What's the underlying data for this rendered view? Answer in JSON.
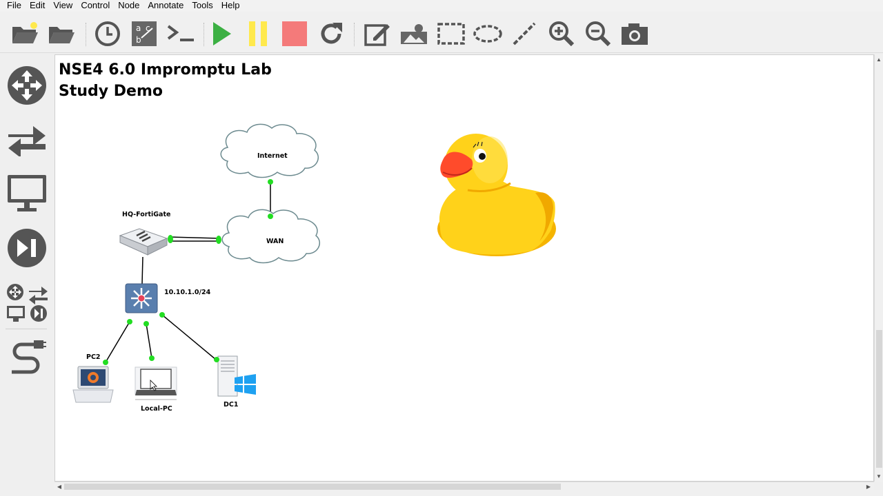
{
  "menu": [
    "File",
    "Edit",
    "View",
    "Control",
    "Node",
    "Annotate",
    "Tools",
    "Help"
  ],
  "toolbar": {
    "buttons": [
      "open-project",
      "open-folder",
      "snapshot-clock",
      "show-hide-interface-labels",
      "console-all",
      "start-all",
      "suspend-all",
      "stop-all",
      "reload-all",
      "add-note",
      "insert-picture",
      "draw-rectangle",
      "draw-ellipse",
      "draw-line",
      "zoom-in",
      "zoom-out",
      "screenshot"
    ],
    "colors": {
      "start": "#3cb043",
      "suspend": "#ffe94d",
      "stop": "#f47a7a",
      "icon": "#555555"
    }
  },
  "dock": [
    "routers",
    "switches",
    "end-devices",
    "security-devices",
    "all-devices",
    "add-link"
  ],
  "canvas": {
    "title_line1": "NSE4 6.0 Impromptu Lab",
    "title_line2": "Study Demo",
    "nodes": {
      "internet": "Internet",
      "wan": "WAN",
      "fortigate": "HQ-FortiGate",
      "switch": "10.10.1.0/24",
      "pc2": "PC2",
      "local_pc": "Local-PC",
      "dc1": "DC1"
    },
    "link_endpoint_color": "#22dd22"
  }
}
